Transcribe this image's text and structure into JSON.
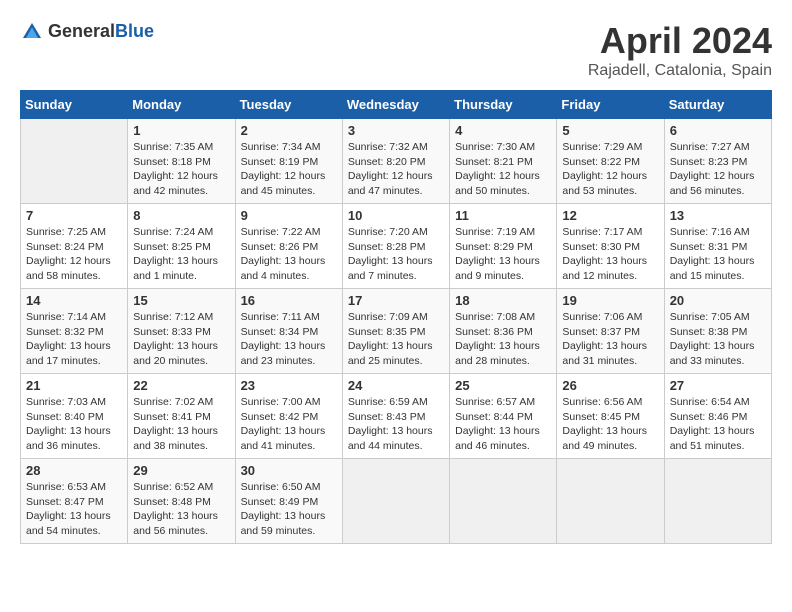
{
  "logo": {
    "general": "General",
    "blue": "Blue"
  },
  "header": {
    "month": "April 2024",
    "location": "Rajadell, Catalonia, Spain"
  },
  "weekdays": [
    "Sunday",
    "Monday",
    "Tuesday",
    "Wednesday",
    "Thursday",
    "Friday",
    "Saturday"
  ],
  "weeks": [
    [
      {
        "day": "",
        "info": ""
      },
      {
        "day": "1",
        "info": "Sunrise: 7:35 AM\nSunset: 8:18 PM\nDaylight: 12 hours\nand 42 minutes."
      },
      {
        "day": "2",
        "info": "Sunrise: 7:34 AM\nSunset: 8:19 PM\nDaylight: 12 hours\nand 45 minutes."
      },
      {
        "day": "3",
        "info": "Sunrise: 7:32 AM\nSunset: 8:20 PM\nDaylight: 12 hours\nand 47 minutes."
      },
      {
        "day": "4",
        "info": "Sunrise: 7:30 AM\nSunset: 8:21 PM\nDaylight: 12 hours\nand 50 minutes."
      },
      {
        "day": "5",
        "info": "Sunrise: 7:29 AM\nSunset: 8:22 PM\nDaylight: 12 hours\nand 53 minutes."
      },
      {
        "day": "6",
        "info": "Sunrise: 7:27 AM\nSunset: 8:23 PM\nDaylight: 12 hours\nand 56 minutes."
      }
    ],
    [
      {
        "day": "7",
        "info": "Sunrise: 7:25 AM\nSunset: 8:24 PM\nDaylight: 12 hours\nand 58 minutes."
      },
      {
        "day": "8",
        "info": "Sunrise: 7:24 AM\nSunset: 8:25 PM\nDaylight: 13 hours\nand 1 minute."
      },
      {
        "day": "9",
        "info": "Sunrise: 7:22 AM\nSunset: 8:26 PM\nDaylight: 13 hours\nand 4 minutes."
      },
      {
        "day": "10",
        "info": "Sunrise: 7:20 AM\nSunset: 8:28 PM\nDaylight: 13 hours\nand 7 minutes."
      },
      {
        "day": "11",
        "info": "Sunrise: 7:19 AM\nSunset: 8:29 PM\nDaylight: 13 hours\nand 9 minutes."
      },
      {
        "day": "12",
        "info": "Sunrise: 7:17 AM\nSunset: 8:30 PM\nDaylight: 13 hours\nand 12 minutes."
      },
      {
        "day": "13",
        "info": "Sunrise: 7:16 AM\nSunset: 8:31 PM\nDaylight: 13 hours\nand 15 minutes."
      }
    ],
    [
      {
        "day": "14",
        "info": "Sunrise: 7:14 AM\nSunset: 8:32 PM\nDaylight: 13 hours\nand 17 minutes."
      },
      {
        "day": "15",
        "info": "Sunrise: 7:12 AM\nSunset: 8:33 PM\nDaylight: 13 hours\nand 20 minutes."
      },
      {
        "day": "16",
        "info": "Sunrise: 7:11 AM\nSunset: 8:34 PM\nDaylight: 13 hours\nand 23 minutes."
      },
      {
        "day": "17",
        "info": "Sunrise: 7:09 AM\nSunset: 8:35 PM\nDaylight: 13 hours\nand 25 minutes."
      },
      {
        "day": "18",
        "info": "Sunrise: 7:08 AM\nSunset: 8:36 PM\nDaylight: 13 hours\nand 28 minutes."
      },
      {
        "day": "19",
        "info": "Sunrise: 7:06 AM\nSunset: 8:37 PM\nDaylight: 13 hours\nand 31 minutes."
      },
      {
        "day": "20",
        "info": "Sunrise: 7:05 AM\nSunset: 8:38 PM\nDaylight: 13 hours\nand 33 minutes."
      }
    ],
    [
      {
        "day": "21",
        "info": "Sunrise: 7:03 AM\nSunset: 8:40 PM\nDaylight: 13 hours\nand 36 minutes."
      },
      {
        "day": "22",
        "info": "Sunrise: 7:02 AM\nSunset: 8:41 PM\nDaylight: 13 hours\nand 38 minutes."
      },
      {
        "day": "23",
        "info": "Sunrise: 7:00 AM\nSunset: 8:42 PM\nDaylight: 13 hours\nand 41 minutes."
      },
      {
        "day": "24",
        "info": "Sunrise: 6:59 AM\nSunset: 8:43 PM\nDaylight: 13 hours\nand 44 minutes."
      },
      {
        "day": "25",
        "info": "Sunrise: 6:57 AM\nSunset: 8:44 PM\nDaylight: 13 hours\nand 46 minutes."
      },
      {
        "day": "26",
        "info": "Sunrise: 6:56 AM\nSunset: 8:45 PM\nDaylight: 13 hours\nand 49 minutes."
      },
      {
        "day": "27",
        "info": "Sunrise: 6:54 AM\nSunset: 8:46 PM\nDaylight: 13 hours\nand 51 minutes."
      }
    ],
    [
      {
        "day": "28",
        "info": "Sunrise: 6:53 AM\nSunset: 8:47 PM\nDaylight: 13 hours\nand 54 minutes."
      },
      {
        "day": "29",
        "info": "Sunrise: 6:52 AM\nSunset: 8:48 PM\nDaylight: 13 hours\nand 56 minutes."
      },
      {
        "day": "30",
        "info": "Sunrise: 6:50 AM\nSunset: 8:49 PM\nDaylight: 13 hours\nand 59 minutes."
      },
      {
        "day": "",
        "info": ""
      },
      {
        "day": "",
        "info": ""
      },
      {
        "day": "",
        "info": ""
      },
      {
        "day": "",
        "info": ""
      }
    ]
  ]
}
